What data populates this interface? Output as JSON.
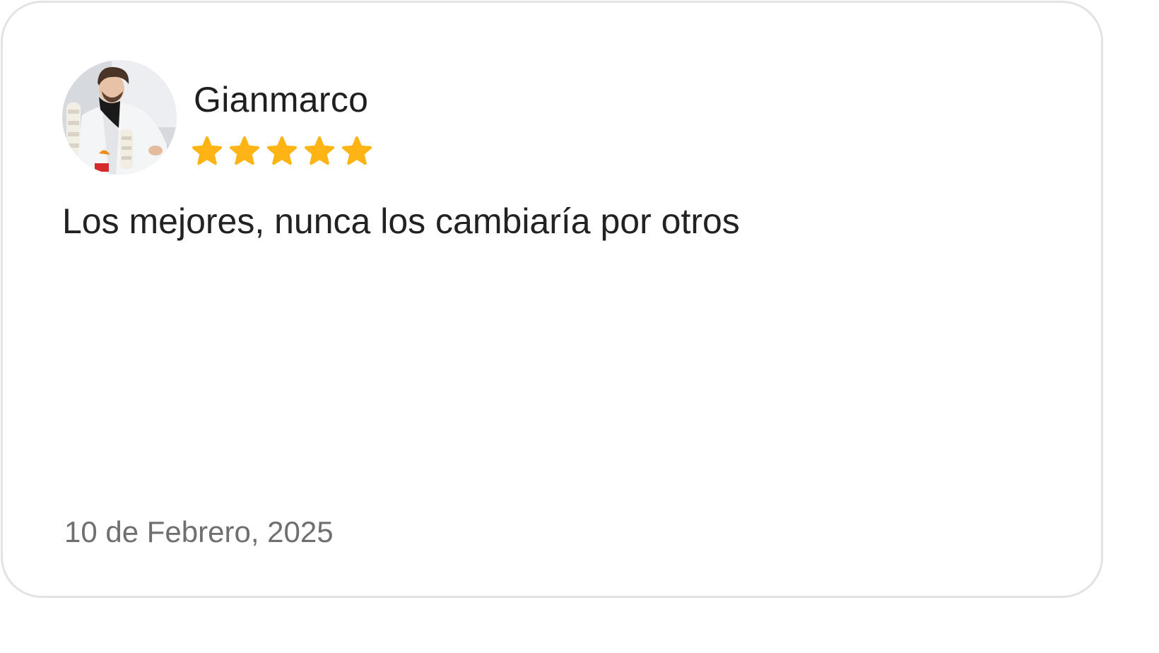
{
  "review": {
    "reviewer_name": "Gianmarco",
    "rating": 5,
    "rating_max": 5,
    "text": "Los mejores, nunca los cambiaría por otros",
    "date": "10 de Febrero, 2025"
  },
  "colors": {
    "star": "#FFB416",
    "card_border": "#E3E3E3",
    "name_text": "#1F1F1F",
    "date_text": "#6F6F6F"
  },
  "icons": {
    "avatar": "user-photo",
    "star": "star-icon"
  }
}
